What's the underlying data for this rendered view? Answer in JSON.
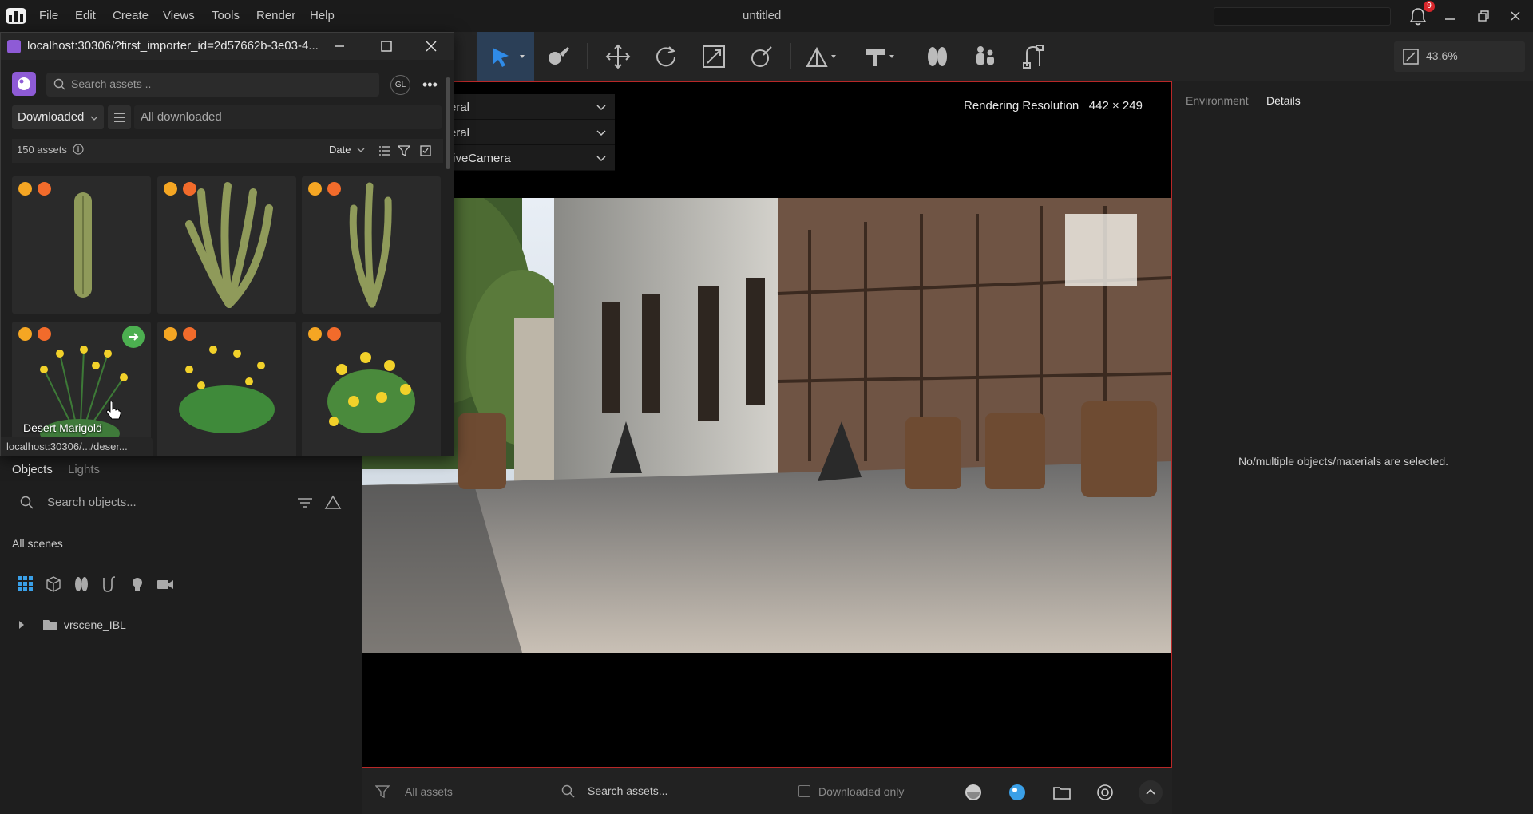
{
  "app": {
    "menu": [
      "File",
      "Edit",
      "Create",
      "Views",
      "Tools",
      "Render",
      "Help"
    ],
    "document_title": "untitled",
    "notification_count": "9"
  },
  "toolbar": {
    "zoom": "43.6%",
    "tools": [
      "select-tool",
      "paint-tool",
      "move-tool",
      "rotate-tool",
      "scale-tool",
      "snap-tool",
      "terrain-tool",
      "hammer-tool",
      "scatter-tool",
      "people-tool",
      "bend-tool"
    ]
  },
  "viewport": {
    "rendering_resolution_label": "Rendering Resolution",
    "rendering_resolution_value": "442 × 249",
    "dropdowns": [
      "eral",
      "eral",
      "tiveCamera"
    ]
  },
  "right_panel": {
    "tabs": [
      "Environment",
      "Details"
    ],
    "active_tab": "Details",
    "empty_message": "No/multiple objects/materials are selected."
  },
  "bottom_bar": {
    "filter_label": "All assets",
    "search_placeholder": "Search assets...",
    "downloaded_only_label": "Downloaded only"
  },
  "left_panel": {
    "tabs": [
      "Objects",
      "Lights"
    ],
    "active_tab": "Objects",
    "search_placeholder": "Search objects...",
    "scenes_label": "All scenes",
    "tree": [
      {
        "label": "vrscene_IBL",
        "type": "folder"
      }
    ]
  },
  "browser_window": {
    "url": "localhost:30306/?first_importer_id=2d57662b-3e03-4...",
    "search_placeholder": "Search assets ..",
    "avatar_initials": "GL",
    "source_filter": "Downloaded",
    "collection_filter": "All downloaded",
    "asset_count": "150 assets",
    "sort": "Date",
    "hover_asset_name": "Desert Marigold",
    "status_url": "localhost:30306/.../deser...",
    "assets": [
      {
        "kind": "cactus"
      },
      {
        "kind": "cactus-cluster"
      },
      {
        "kind": "cactus-tall"
      },
      {
        "kind": "flower",
        "hovered": true
      },
      {
        "kind": "flower"
      },
      {
        "kind": "flower"
      }
    ]
  },
  "colors": {
    "accent": "#2b3f57",
    "viewport_border": "#b82828",
    "badge_a": "#f5a623",
    "badge_b": "#f26b2b",
    "import_green": "#4caf50"
  }
}
